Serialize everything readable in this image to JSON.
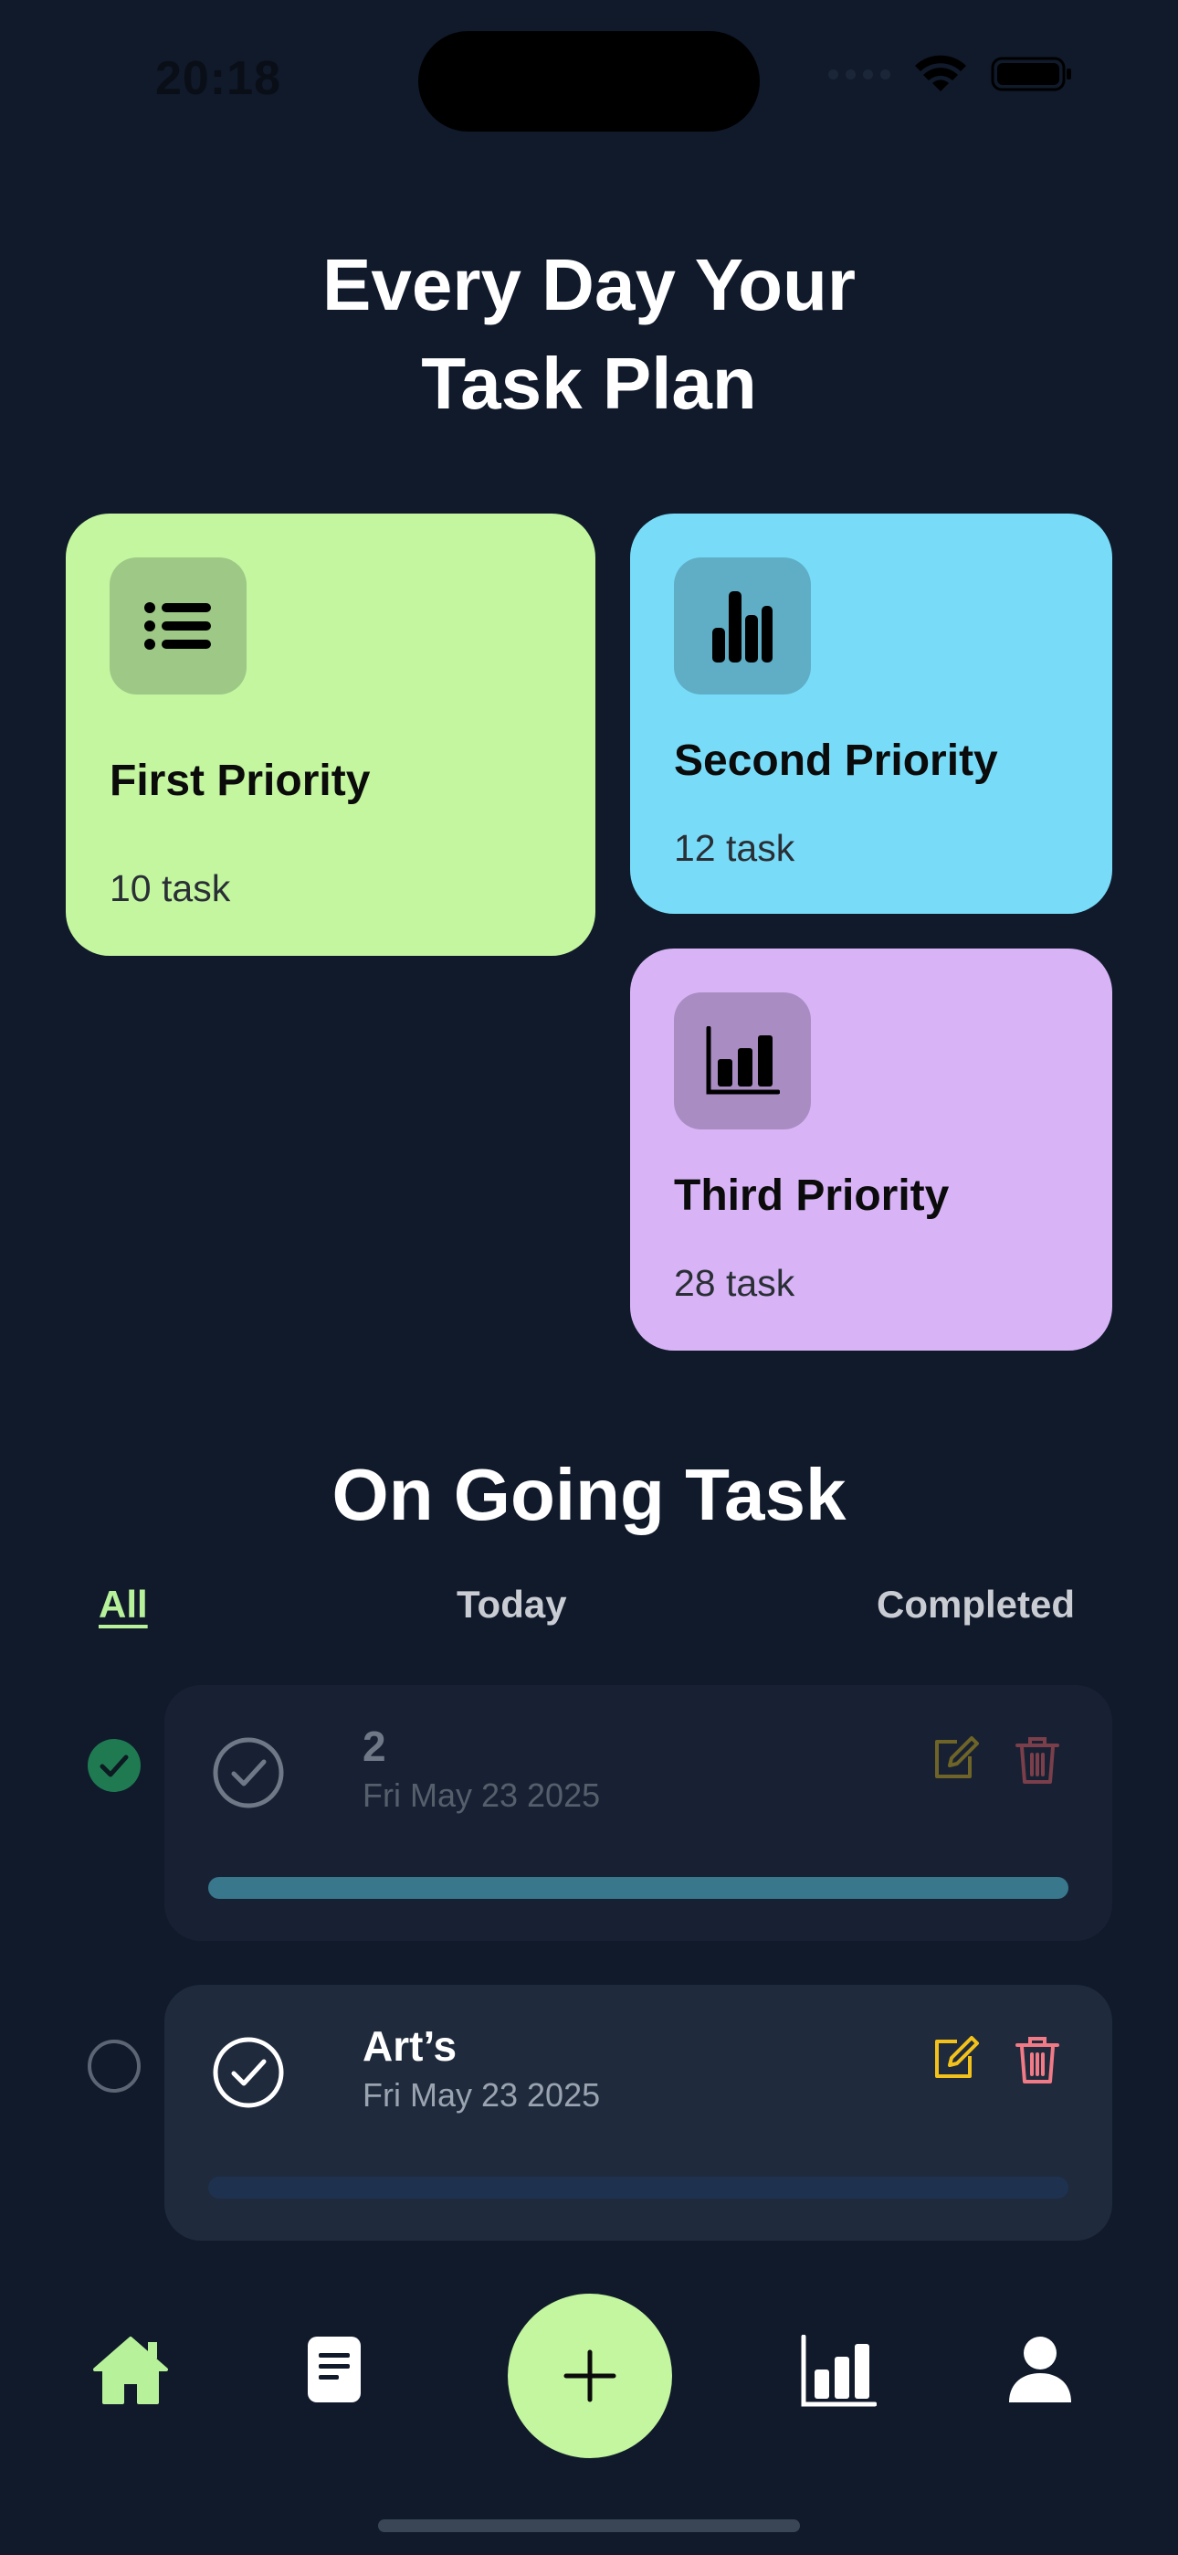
{
  "status_bar": {
    "time": "20:18"
  },
  "header": {
    "title_line1": "Every Day Your",
    "title_line2": "Task Plan"
  },
  "priorities": [
    {
      "title": "First Priority",
      "count": "10 task",
      "icon": "list-icon",
      "color": "#c3f69f"
    },
    {
      "title": "Second Priority",
      "count": "12 task",
      "icon": "bar-chart-icon",
      "color": "#78dcf9"
    },
    {
      "title": "Third Priority",
      "count": "28 task",
      "icon": "column-chart-icon",
      "color": "#d8b4f7"
    }
  ],
  "ongoing": {
    "title": "On Going Task",
    "tabs": [
      "All",
      "Today",
      "Completed"
    ],
    "active_tab": "All"
  },
  "tasks": [
    {
      "name": "2",
      "date": "Fri May 23 2025",
      "completed": true,
      "progress": 1.0
    },
    {
      "name": "Art’s",
      "date": "Fri May 23 2025",
      "completed": false,
      "progress": 0.0
    }
  ],
  "nav": {
    "items": [
      "home-icon",
      "document-icon",
      "add-icon",
      "stats-icon",
      "profile-icon"
    ],
    "active": "home-icon"
  },
  "colors": {
    "background": "#101a2b",
    "accent_green": "#c3f69f",
    "edit_yellow": "#f2c21b",
    "delete_red": "#f07a86",
    "check_green": "#1f7a52"
  }
}
